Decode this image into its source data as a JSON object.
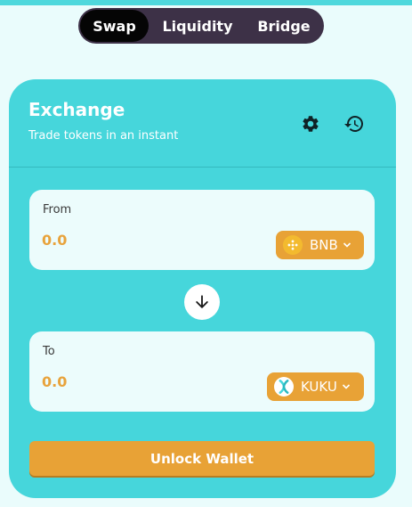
{
  "nav": {
    "tabs": [
      {
        "label": "Swap",
        "active": true
      },
      {
        "label": "Liquidity",
        "active": false
      },
      {
        "label": "Bridge",
        "active": false
      }
    ]
  },
  "exchange": {
    "title": "Exchange",
    "subtitle": "Trade tokens in an instant",
    "settings_icon": "gear-icon",
    "history_icon": "history-icon"
  },
  "from": {
    "label": "From",
    "amount": "0.0",
    "token": "BNB"
  },
  "to": {
    "label": "To",
    "amount": "0.0",
    "token": "KUKU"
  },
  "switch_icon": "arrow-down-icon",
  "action": {
    "label": "Unlock Wallet"
  },
  "colors": {
    "accent": "#e8a236",
    "card": "#46d6db",
    "nav_bg": "#3d3147",
    "amount": "#e8a33c"
  }
}
